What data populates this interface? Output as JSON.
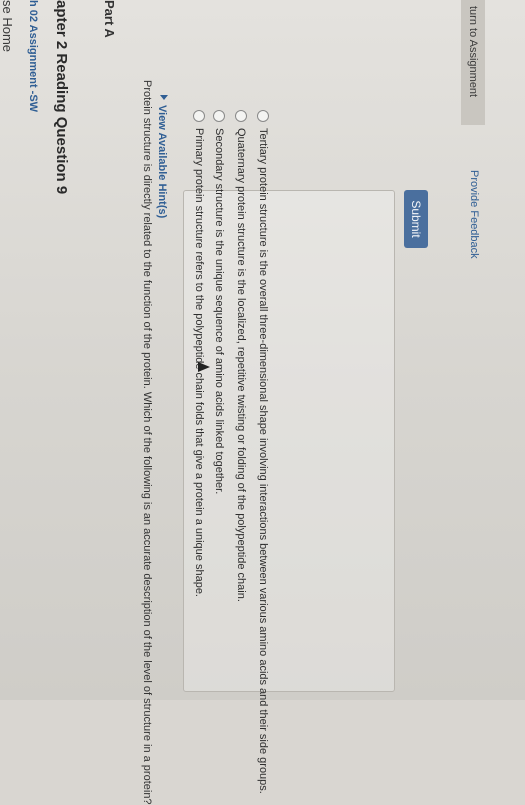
{
  "nav": {
    "home": "se Home",
    "assignment": "h 02 Assignment -SW"
  },
  "question": {
    "title": "apter 2 Reading Question 9",
    "part": "Part A",
    "prompt": "Protein structure is directly related to the function of the protein. Which of the following is an accurate description of the level of structure in a protein?",
    "hint": "View Available Hint(s)"
  },
  "choices": [
    "Primary protein structure refers to the polypeptide chain folds that give a protein a unique shape.",
    "Secondary structure is the unique sequence of amino acids linked together.",
    "Quaternary protein structure is the localized, repetitive twisting or folding of the polypeptide chain.",
    "Tertiary protein structure is the overall three-dimensional shape involving interactions between various amino acids and their side groups."
  ],
  "actions": {
    "submit": "Submit",
    "return": "turn to Assignment",
    "feedback": "Provide Feedback"
  }
}
